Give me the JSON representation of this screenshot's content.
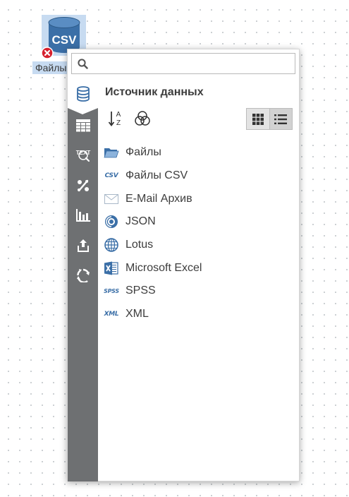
{
  "canvas": {
    "node": {
      "icon_text": "CSV",
      "label": "Файлы CSV",
      "status": "error"
    }
  },
  "panel": {
    "search": {
      "value": "",
      "placeholder": ""
    },
    "sidebar": {
      "items": [
        {
          "icon": "database-icon",
          "active": true
        },
        {
          "icon": "table-icon"
        },
        {
          "icon": "text-search-icon",
          "text": "TEXT"
        },
        {
          "icon": "percent-icon"
        },
        {
          "icon": "bar-chart-icon"
        },
        {
          "icon": "export-icon"
        },
        {
          "icon": "recycle-icon"
        }
      ]
    },
    "title": "Источник данных",
    "toolbar": {
      "sort_icon": "sort-az-icon",
      "sort_letters": [
        "A",
        "Z"
      ],
      "filter_icon": "venn-icon",
      "view_grid_icon": "grid-view-icon",
      "view_list_icon": "list-view-icon",
      "active_view": "list"
    },
    "sources": [
      {
        "label": "Файлы",
        "icon": "folder-icon"
      },
      {
        "label": "Файлы CSV",
        "icon": "csv-icon",
        "icon_text": "CSV"
      },
      {
        "label": "E-Mail Архив",
        "icon": "envelope-icon"
      },
      {
        "label": "JSON",
        "icon": "json-icon"
      },
      {
        "label": "Lotus",
        "icon": "lotus-icon"
      },
      {
        "label": "Microsoft Excel",
        "icon": "excel-icon"
      },
      {
        "label": "SPSS",
        "icon": "spss-icon",
        "icon_text": "SPSS"
      },
      {
        "label": "XML",
        "icon": "xml-icon",
        "icon_text": "XML"
      }
    ]
  },
  "colors": {
    "accent": "#3b6fa7",
    "sidebar": "#6e7072",
    "selection": "#c7dbf1",
    "error": "#d6202e"
  }
}
